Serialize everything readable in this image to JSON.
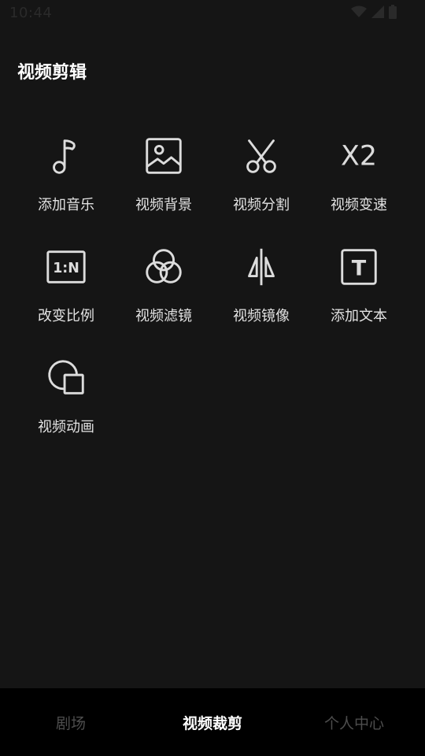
{
  "status_bar": {
    "time": "10:44",
    "icons": [
      "wifi-icon",
      "signal-icon",
      "battery-icon"
    ]
  },
  "header": {
    "title": "视频剪辑"
  },
  "tools": [
    {
      "label": "添加音乐",
      "icon": "music-note-icon"
    },
    {
      "label": "视频背景",
      "icon": "image-icon"
    },
    {
      "label": "视频分割",
      "icon": "scissors-icon"
    },
    {
      "label": "视频变速",
      "icon": "speed-x2-icon"
    },
    {
      "label": "改变比例",
      "icon": "aspect-ratio-icon"
    },
    {
      "label": "视频滤镜",
      "icon": "filter-circles-icon"
    },
    {
      "label": "视频镜像",
      "icon": "mirror-icon"
    },
    {
      "label": "添加文本",
      "icon": "text-icon"
    },
    {
      "label": "视频动画",
      "icon": "animation-shapes-icon"
    }
  ],
  "speed_icon_text": "X2",
  "ratio_icon_text": "1:N",
  "text_icon_text": "T",
  "bottom_nav": {
    "items": [
      {
        "label": "剧场",
        "active": false
      },
      {
        "label": "视频裁剪",
        "active": true
      },
      {
        "label": "个人中心",
        "active": false
      }
    ]
  },
  "colors": {
    "background": "#151515",
    "nav_background": "#000000",
    "active_nav": "#ffffff",
    "inactive_nav": "#4d4d4d",
    "icon_stroke": "#dcdcdc"
  }
}
